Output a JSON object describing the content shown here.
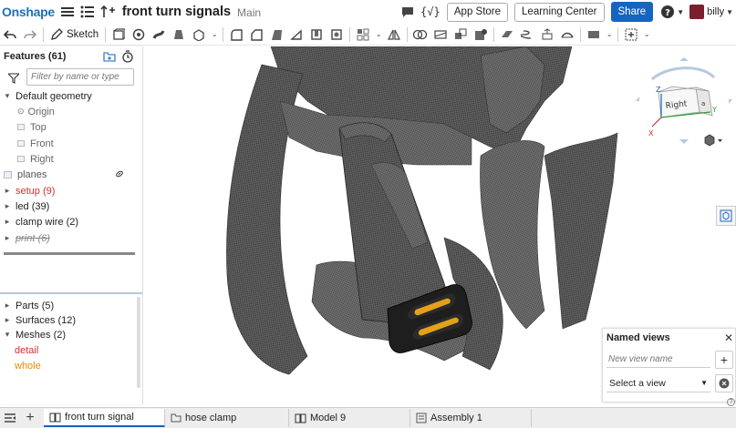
{
  "header": {
    "logo": "Onshape",
    "doc_title": "front turn signals",
    "branch": "Main",
    "app_store": "App Store",
    "learning_center": "Learning Center",
    "share": "Share",
    "user": "billy"
  },
  "toolbar": {
    "sketch": "Sketch"
  },
  "features": {
    "title": "Features (61)",
    "filter_placeholder": "Filter by name or type",
    "default_geometry": "Default geometry",
    "origin": "Origin",
    "top": "Top",
    "front": "Front",
    "right": "Right",
    "planes": "planes",
    "setup": "setup (9)",
    "led": "led (39)",
    "clamp_wire": "clamp wire (2)",
    "print": "print (6)"
  },
  "parts": {
    "parts": "Parts (5)",
    "surfaces": "Surfaces (12)",
    "meshes": "Meshes (2)",
    "detail": "detail",
    "whole": "whole"
  },
  "viewcube": {
    "face": "Right",
    "axis_x": "X",
    "axis_y": "Y",
    "axis_z": "Z"
  },
  "named_views": {
    "title": "Named views",
    "input_placeholder": "New view name",
    "select": "Select a view"
  },
  "tabs": [
    "front turn signal",
    "hose clamp",
    "Model 9",
    "Assembly 1"
  ],
  "colors": {
    "accent": "#1565c0",
    "logo": "#1d72b8",
    "error": "#d32f2f",
    "warn": "#e68a00",
    "mesh": "#555555",
    "led": "#e3a21a"
  }
}
